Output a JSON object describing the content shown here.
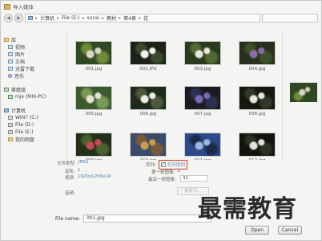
{
  "window": {
    "title": "导入媒体"
  },
  "address": {
    "crumbs": [
      "计算机",
      "File (E:)",
      "sucai",
      "教材",
      "第4章",
      "花"
    ]
  },
  "sidebar": {
    "library": {
      "label": "库",
      "items": [
        "视频",
        "图片",
        "文档",
        "迅雷下载",
        "音乐"
      ]
    },
    "homegroup": {
      "label": "家庭组",
      "items": [
        "mjx (MIX-PC)"
      ]
    },
    "computer": {
      "label": "计算机",
      "items": [
        "WIN7 (C:)",
        "File (D:)",
        "File (E:)",
        "我的网盘"
      ]
    }
  },
  "thumbnails": [
    {
      "name": "001.jpg",
      "colors": [
        "#2f4a22",
        "#d9d6c8",
        "#6f8a3a"
      ]
    },
    {
      "name": "002.JPG",
      "colors": [
        "#1d2218",
        "#f2f2ee",
        "#3a4a2a"
      ]
    },
    {
      "name": "003.jpg",
      "colors": [
        "#2a3a1e",
        "#e8e6e0",
        "#536b33"
      ]
    },
    {
      "name": "004.jpg",
      "colors": [
        "#26301c",
        "#8a6fa8",
        "#3e5228"
      ]
    },
    {
      "name": "005.jpg",
      "colors": [
        "#3c5a2c",
        "#e5e2d8",
        "#7a9a5a"
      ]
    },
    {
      "name": "006.jpg",
      "colors": [
        "#1e2a1a",
        "#eceee8",
        "#4a5a3a"
      ]
    },
    {
      "name": "007.jpg",
      "colors": [
        "#1b1c22",
        "#7a6ab8",
        "#2d3050"
      ]
    },
    {
      "name": "008.jpg",
      "colors": [
        "#16180f",
        "#e9e9e3",
        "#303826"
      ]
    },
    {
      "name": "009.jpg",
      "colors": [
        "#233018",
        "#c84a5a",
        "#4c6030"
      ]
    },
    {
      "name": "010.jpg",
      "colors": [
        "#3a4a6a",
        "#c9a04a",
        "#7a5a3a"
      ]
    },
    {
      "name": "011.jpg",
      "colors": [
        "#2a4a8a",
        "#9ab8e0",
        "#1a2a4a"
      ]
    },
    {
      "name": "012.jpg",
      "colors": [
        "#121410",
        "#e0e4dc",
        "#2a3222"
      ]
    }
  ],
  "details": {
    "file_type_label": "文件类型:",
    "file_type_value": "JPEG",
    "channels_label": "音轨:",
    "channels_value": "1",
    "video_label": "视频:",
    "video_value": "1920x1200x24",
    "audio_label": "音频:",
    "sequence_label": "序列:",
    "open_sequence_label": "打开序列",
    "first_frame_label": "第一帧图像:",
    "first_frame_value": "1",
    "last_frame_label": "最后一帧图像:",
    "last_frame_value": "31",
    "custom_button": "自定义..."
  },
  "file_name": {
    "label": "File name:",
    "value": "001.jpg"
  },
  "buttons": {
    "open": "Open",
    "cancel": "Cancel"
  },
  "watermark": "最需教育"
}
